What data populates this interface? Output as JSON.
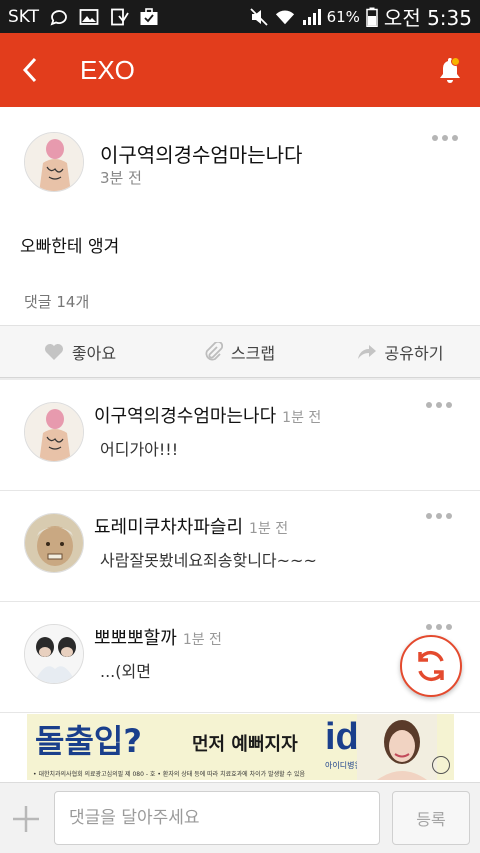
{
  "status_bar": {
    "carrier": "SKT",
    "battery": "61%",
    "time_label": "오전 5:35",
    "icons": [
      "chat-bubble-icon",
      "image-icon",
      "download-icon",
      "briefcase-icon",
      "mute-icon",
      "wifi-icon",
      "signal-icon",
      "battery-icon"
    ]
  },
  "app_bar": {
    "title": "EXO",
    "back_icon": "chevron-left-icon",
    "bell_icon": "bell-icon",
    "accent": "#e23d1c"
  },
  "post": {
    "author": "이구역의경수엄마는나다",
    "time": "3분 전",
    "body": "오빠한테 앵겨",
    "comment_count": "댓글 14개"
  },
  "actions": {
    "like": "좋아요",
    "scrap": "스크랩",
    "share": "공유하기"
  },
  "comments": [
    {
      "author": "이구역의경수엄마는나다",
      "time": "1분 전",
      "text": "어디가아!!!"
    },
    {
      "author": "됴레미쿠차차파슬리",
      "time": "1분 전",
      "text": "사람잘못봤네요죄송핮니다~~~"
    },
    {
      "author": "뽀뽀뽀할까",
      "time": "1분 전",
      "text": "...(외면"
    }
  ],
  "ad": {
    "headline": "돌출입?",
    "sub": "먼저 예뻐지자",
    "logo": "id",
    "logo_sub": "아이디병원 치과",
    "fine_print": "• 대한치과의사협회 의료광고심의필 제 080 - 호 • 환자의 상태 등에 따라 치료효과에 차이가 발생할 수 있음"
  },
  "input_bar": {
    "placeholder": "댓글을 달아주세요",
    "submit_label": "등록",
    "plus_icon": "plus-icon",
    "refresh_icon": "refresh-icon"
  }
}
